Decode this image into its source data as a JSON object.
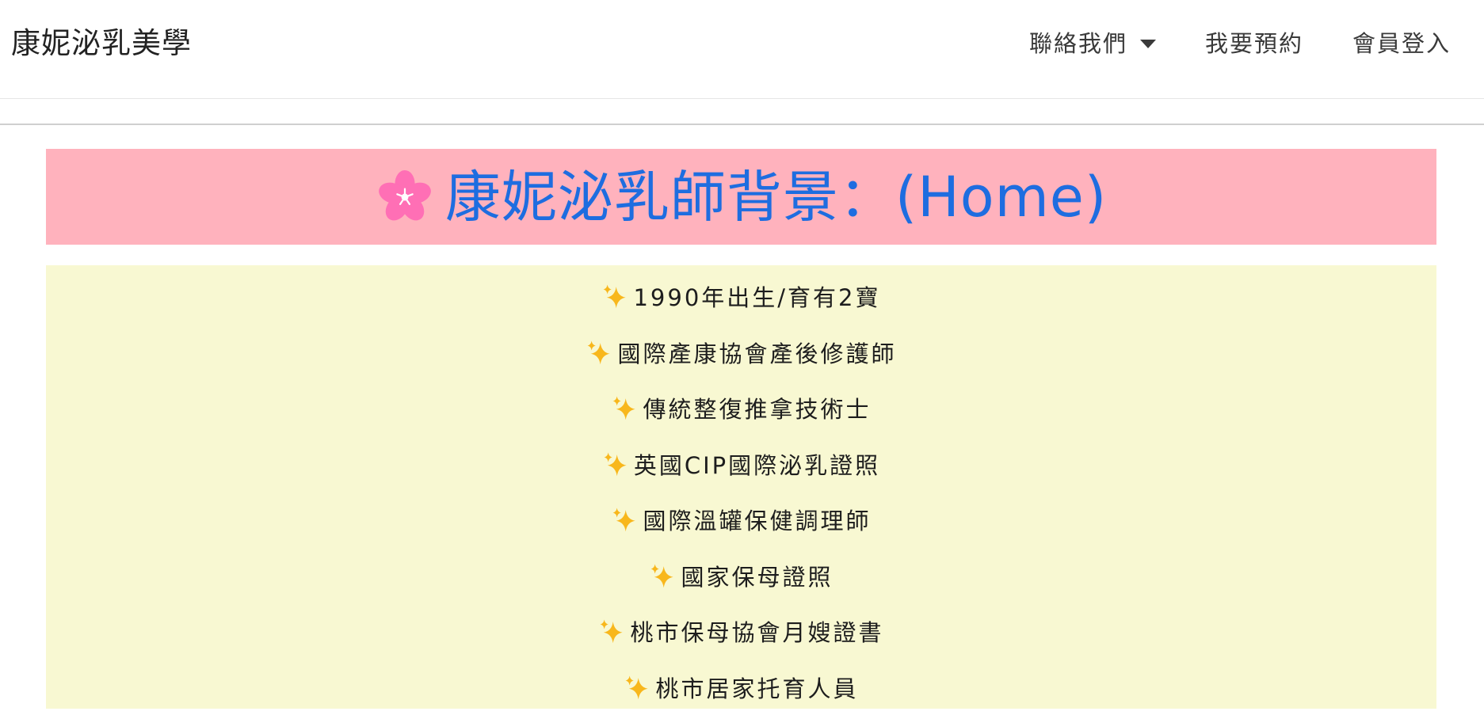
{
  "navbar": {
    "brand": "康妮泌乳美學",
    "links": [
      {
        "label": "聯絡我們",
        "has_dropdown": true
      },
      {
        "label": "我要預約",
        "has_dropdown": false
      },
      {
        "label": "會員登入",
        "has_dropdown": false
      }
    ]
  },
  "hero": {
    "title": "康妮泌乳師背景：(Home)",
    "icon": "cherry-blossom-icon",
    "background_color": "#ffb2bd",
    "title_color": "#1e6de0"
  },
  "credentials": {
    "background_color": "#f8f8d2",
    "bullet_icon": "sparkles-icon",
    "items": [
      "1990年出生/育有2寶",
      "國際產康協會產後修護師",
      "傳統整復推拿技術士",
      "英國CIP國際泌乳證照",
      "國際溫罐保健調理師",
      "國家保母證照",
      "桃市保母協會月嫂證書",
      "桃市居家托育人員"
    ]
  }
}
